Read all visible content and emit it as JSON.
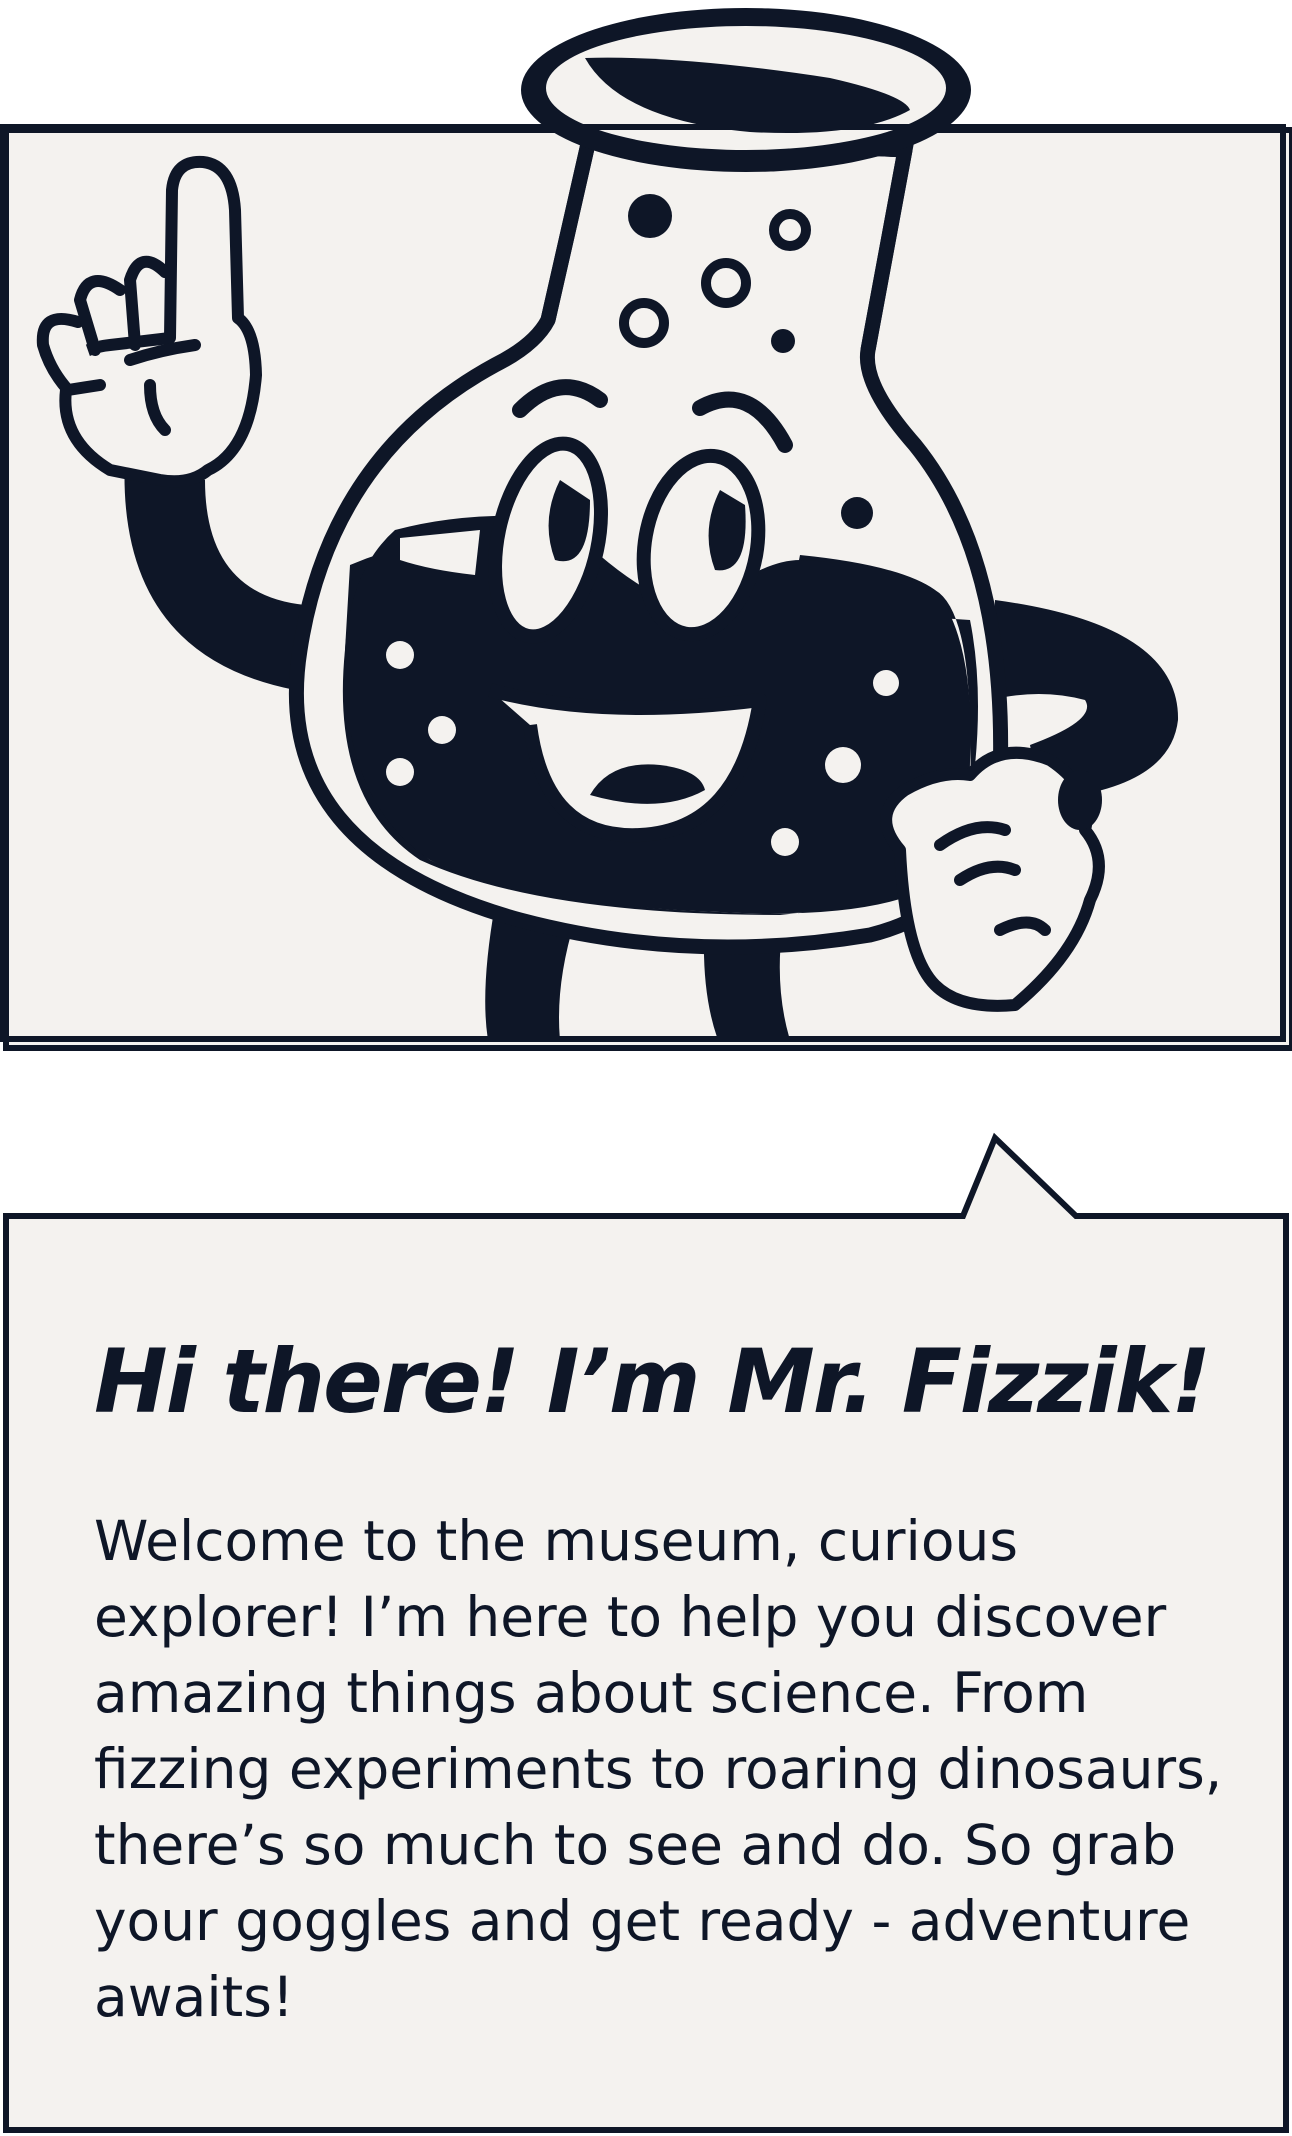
{
  "colors": {
    "ink": "#0e1627",
    "paper": "#f4f2ef",
    "page": "#ffffff"
  },
  "mascot": {
    "name": "Mr. Fizzik",
    "icon": "flask-mascot-icon"
  },
  "speech_bubble": {
    "title": "Hi there! I’m Mr. Fizzik!",
    "body": "Welcome to the museum, curious explorer! I’m here to help you discover amazing things about science. From fizzing experiments to roaring dinosaurs, there’s so much to see and do. So grab your goggles and get ready - adventure awaits!"
  }
}
